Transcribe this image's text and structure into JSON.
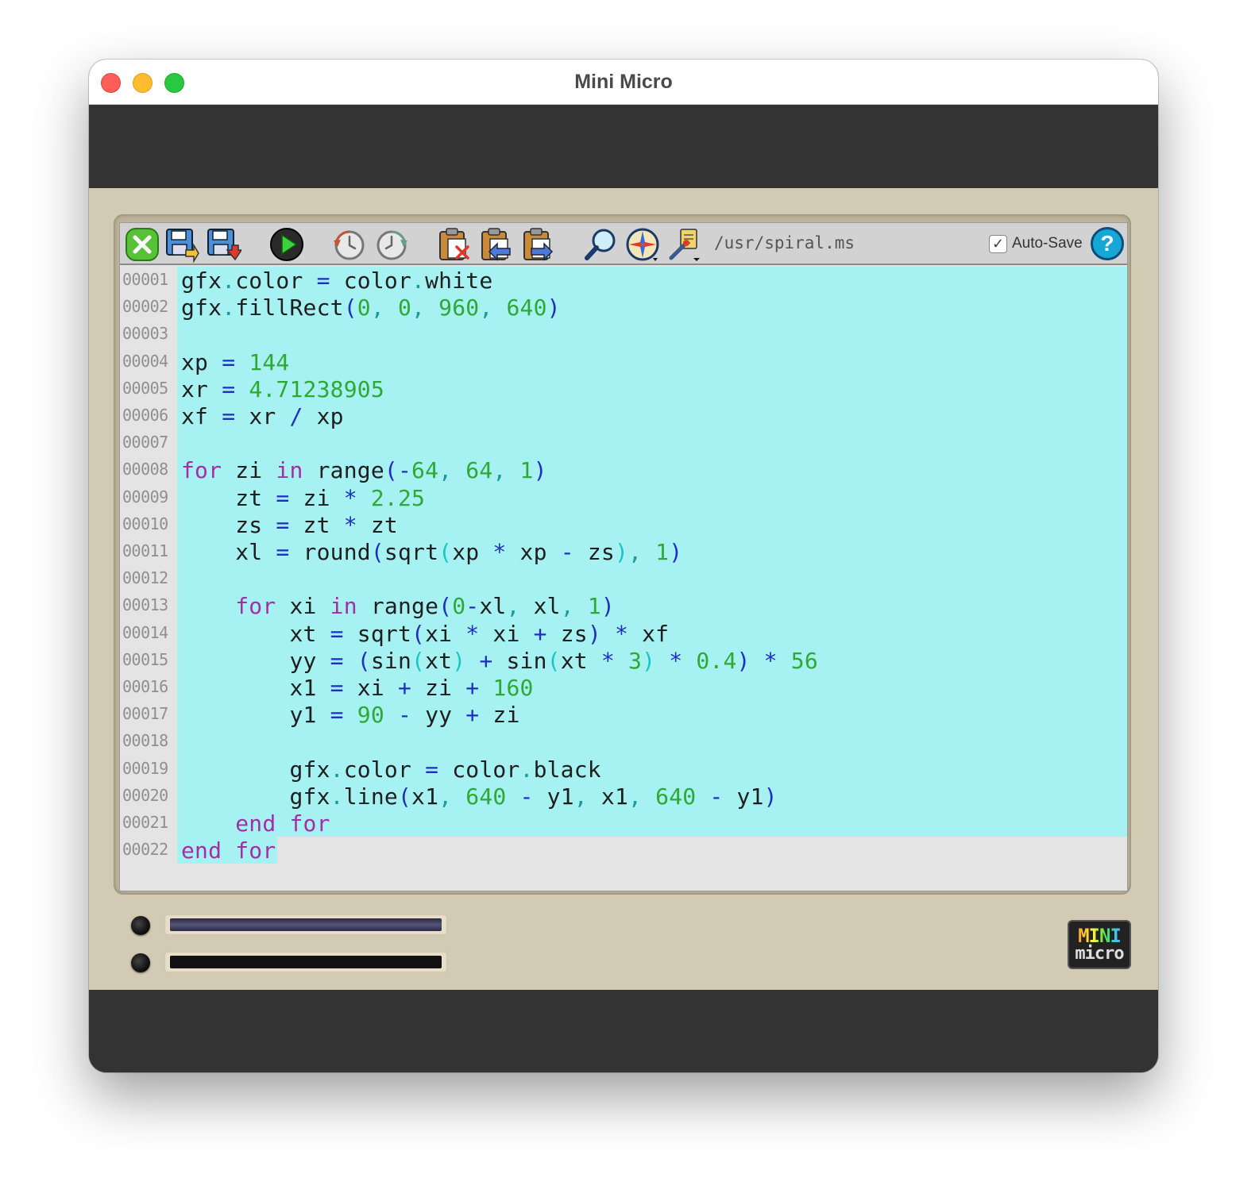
{
  "window": {
    "title": "Mini Micro"
  },
  "toolbar": {
    "icons": [
      "close-editor-icon",
      "save-icon",
      "save-as-icon",
      "run-icon",
      "undo-icon",
      "redo-icon",
      "cut-icon",
      "copy-icon",
      "paste-icon",
      "find-icon",
      "navigate-icon",
      "code-tools-icon"
    ],
    "file_path": "/usr/spiral.ms",
    "auto_save_label": "Auto-Save",
    "auto_save_checked": "✓",
    "help_label": "?"
  },
  "editor": {
    "lines": [
      {
        "num": "00001",
        "code": "gfx.color = color.white"
      },
      {
        "num": "00002",
        "code": "gfx.fillRect(0, 0, 960, 640)"
      },
      {
        "num": "00003",
        "code": ""
      },
      {
        "num": "00004",
        "code": "xp = 144"
      },
      {
        "num": "00005",
        "code": "xr = 4.71238905"
      },
      {
        "num": "00006",
        "code": "xf = xr / xp"
      },
      {
        "num": "00007",
        "code": ""
      },
      {
        "num": "00008",
        "code": "for zi in range(-64, 64, 1)"
      },
      {
        "num": "00009",
        "code": "    zt = zi * 2.25"
      },
      {
        "num": "00010",
        "code": "    zs = zt * zt"
      },
      {
        "num": "00011",
        "code": "    xl = round(sqrt(xp * xp - zs), 1)"
      },
      {
        "num": "00012",
        "code": ""
      },
      {
        "num": "00013",
        "code": "    for xi in range(0-xl, xl, 1)"
      },
      {
        "num": "00014",
        "code": "        xt = sqrt(xi * xi + zs) * xf"
      },
      {
        "num": "00015",
        "code": "        yy = (sin(xt) + sin(xt * 3) * 0.4) * 56"
      },
      {
        "num": "00016",
        "code": "        x1 = xi + zi + 160"
      },
      {
        "num": "00017",
        "code": "        y1 = 90 - yy + zi"
      },
      {
        "num": "00018",
        "code": ""
      },
      {
        "num": "00019",
        "code": "        gfx.color = color.black"
      },
      {
        "num": "00020",
        "code": "        gfx.line(x1, 640 - y1, x1, 640 - y1)"
      },
      {
        "num": "00021",
        "code": "    end for"
      },
      {
        "num": "00022",
        "code": "end for"
      }
    ]
  },
  "logo": {
    "top": "MINI",
    "bottom": "micro"
  },
  "colors": {
    "selection": "#a6f2f2",
    "keyword": "#a32ea6",
    "number": "#2fa835",
    "operator": "#1d2ec0",
    "bezel": "#d3cab3"
  }
}
